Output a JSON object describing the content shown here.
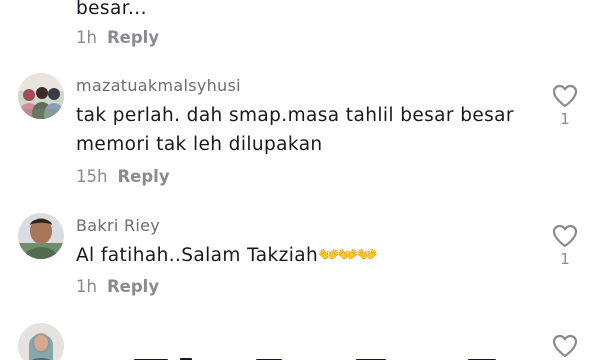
{
  "comments": [
    {
      "username": "",
      "text": "besar...",
      "time": "1h",
      "reply_label": "Reply"
    },
    {
      "username": "mazatuakmalsyhusi",
      "text": "tak perlah. dah smap.masa tahlil besar besar memori tak leh dilupakan",
      "time": "15h",
      "reply_label": "Reply",
      "like_count": "1"
    },
    {
      "username": "Bakri Riey",
      "text": "Al fatihah..Salam Takziah",
      "emoji": "👐👐👐",
      "time": "1h",
      "reply_label": "Reply",
      "like_count": "1"
    },
    {
      "username": "",
      "text": "",
      "like_count": ""
    }
  ],
  "icons": {
    "like": "heart-outline-icon"
  },
  "colors": {
    "text": "#161823",
    "secondary": "#8a8b91",
    "username": "#6b6d76",
    "clap_emoji": "#f7c21b"
  }
}
